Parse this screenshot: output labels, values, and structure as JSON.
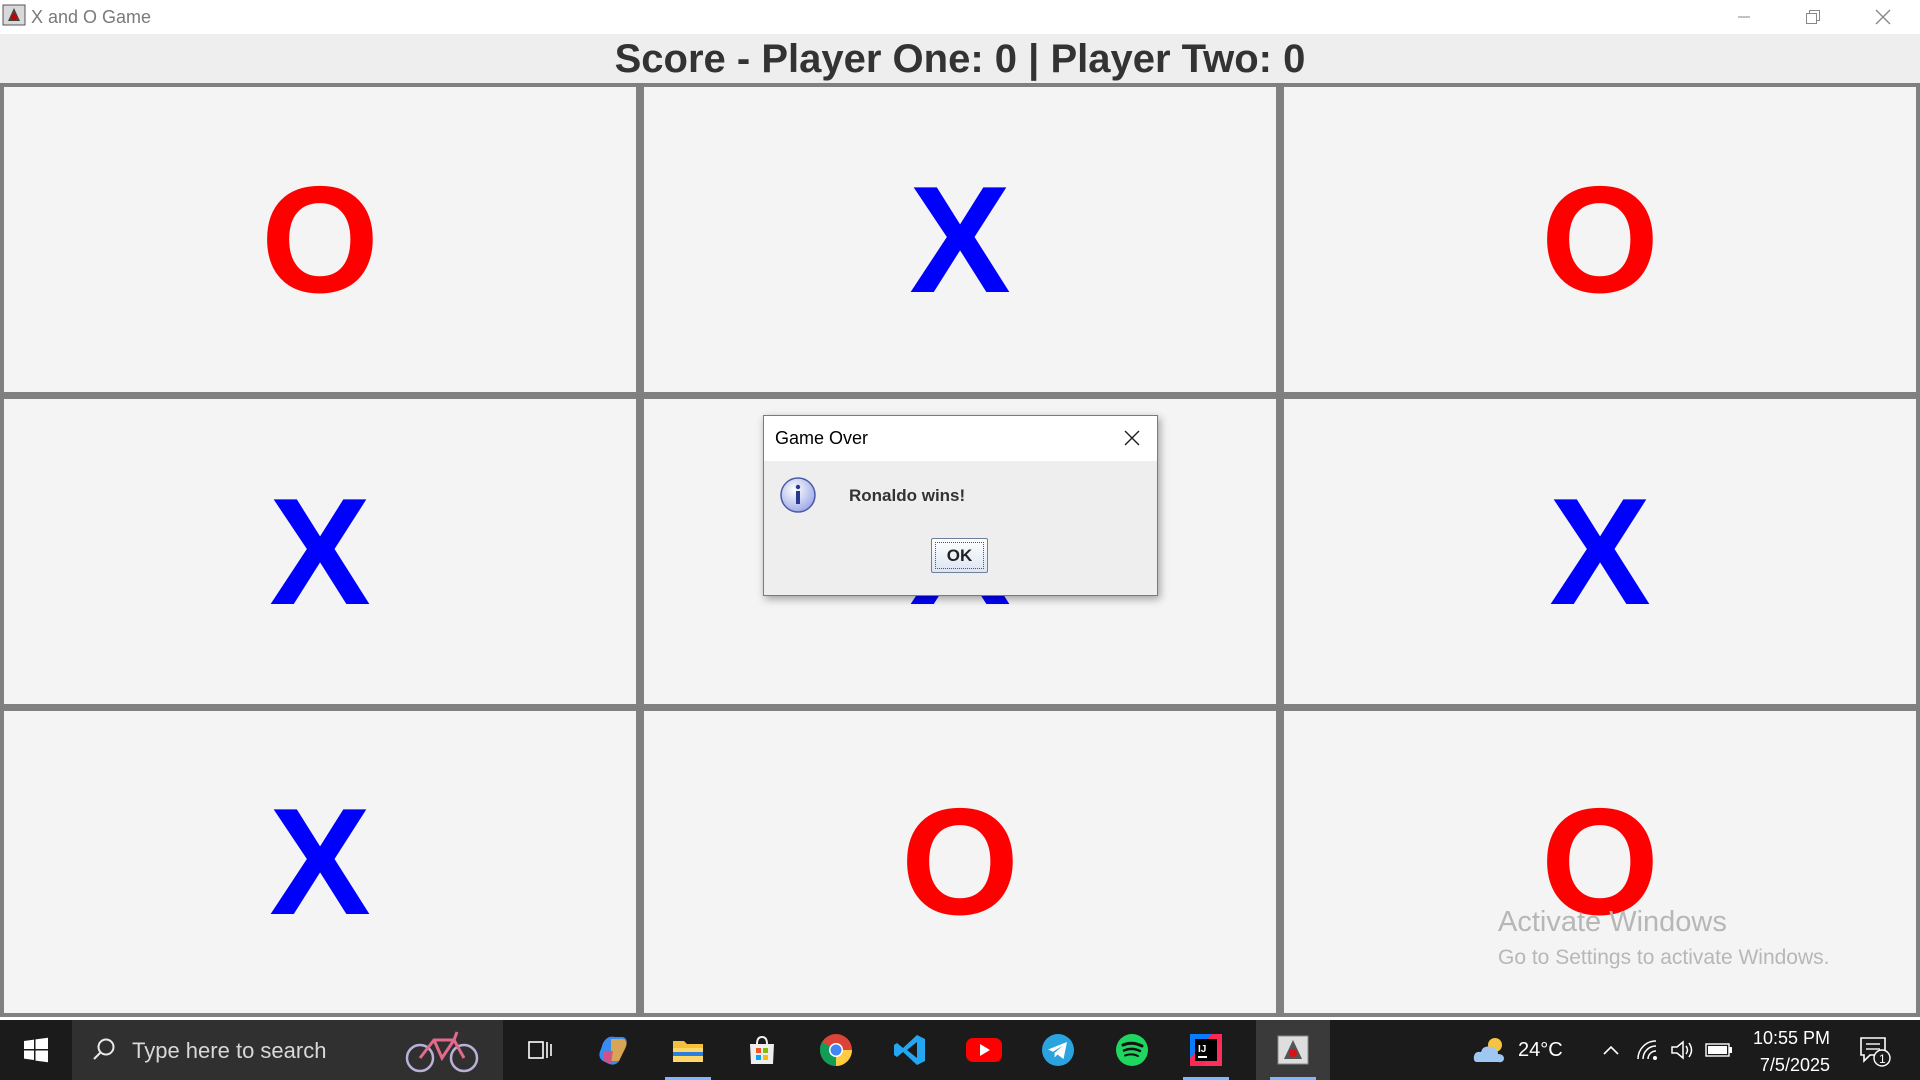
{
  "window": {
    "title": "X and O Game"
  },
  "score": {
    "text": "Score - Player One: 0 | Player Two: 0"
  },
  "board": {
    "cells": [
      "O",
      "X",
      "O",
      "X",
      "X",
      "X",
      "X",
      "O",
      "O"
    ]
  },
  "colors": {
    "x_mark": "#0000ff",
    "o_mark": "#ff0000",
    "grid": "#808080",
    "cell_bg": "#f4f4f4"
  },
  "dialog": {
    "title": "Game Over",
    "icon": "info-icon",
    "message": "Ronaldo wins!",
    "ok_label": "OK"
  },
  "watermark": {
    "line1": "Activate Windows",
    "line2": "Go to Settings to activate Windows."
  },
  "taskbar": {
    "search_placeholder": "Type here to search",
    "apps": [
      "task-view-icon",
      "copilot-icon",
      "file-explorer-icon",
      "microsoft-store-icon",
      "chrome-icon",
      "vscode-icon",
      "youtube-icon",
      "telegram-icon",
      "spotify-icon",
      "intellij-icon",
      "java-app-icon"
    ],
    "weather_temp": "24°C",
    "time": "10:55 PM",
    "date": "7/5/2025",
    "notification_count": "1"
  }
}
